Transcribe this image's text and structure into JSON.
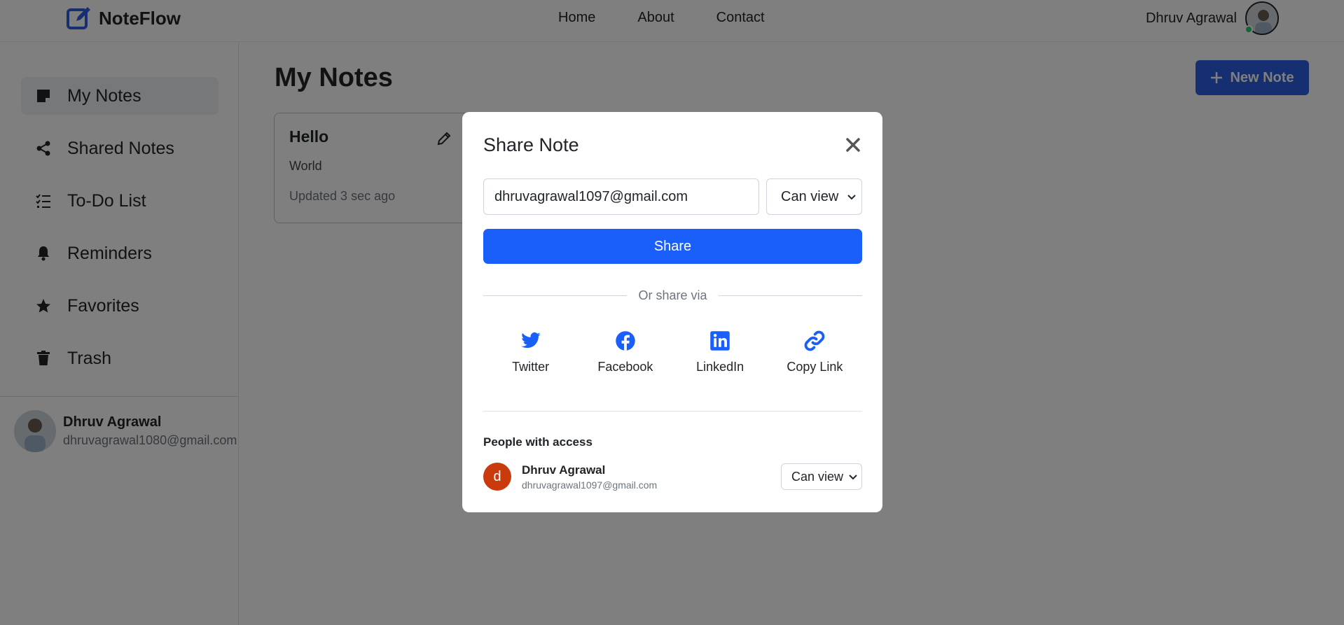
{
  "app": {
    "name": "NoteFlow"
  },
  "nav": {
    "links": [
      "Home",
      "About",
      "Contact"
    ]
  },
  "user": {
    "name": "Dhruv Agrawal",
    "sidebar_email": "dhruvagrawal1080@gmail.com"
  },
  "sidebar": {
    "items": [
      {
        "label": "My Notes",
        "icon": "sticky-note-icon",
        "active": true
      },
      {
        "label": "Shared Notes",
        "icon": "share-nodes-icon",
        "active": false
      },
      {
        "label": "To-Do List",
        "icon": "list-check-icon",
        "active": false
      },
      {
        "label": "Reminders",
        "icon": "bell-icon",
        "active": false
      },
      {
        "label": "Favorites",
        "icon": "star-icon",
        "active": false
      },
      {
        "label": "Trash",
        "icon": "trash-icon",
        "active": false
      }
    ]
  },
  "main": {
    "title": "My Notes",
    "new_note_label": "New Note",
    "notes": [
      {
        "title": "Hello",
        "body": "World",
        "updated": "Updated 3 sec ago"
      }
    ]
  },
  "modal": {
    "title": "Share Note",
    "email_value": "dhruvagrawal1097@gmail.com",
    "permission": "Can view",
    "share_label": "Share",
    "divider_text": "Or share via",
    "socials": [
      {
        "label": "Twitter",
        "icon": "twitter-icon"
      },
      {
        "label": "Facebook",
        "icon": "facebook-icon"
      },
      {
        "label": "LinkedIn",
        "icon": "linkedin-icon"
      },
      {
        "label": "Copy Link",
        "icon": "link-icon"
      }
    ],
    "access_heading": "People with access",
    "access": [
      {
        "initial": "d",
        "name": "Dhruv Agrawal",
        "email": "dhruvagrawal1097@gmail.com",
        "permission": "Can view"
      }
    ]
  },
  "colors": {
    "brand_blue": "#2a5fe0",
    "share_blue": "#1a5ffa",
    "avatar_orange": "#c93a0d",
    "online_green": "#28c76f",
    "overlay": "rgba(0,0,0,0.5)"
  }
}
